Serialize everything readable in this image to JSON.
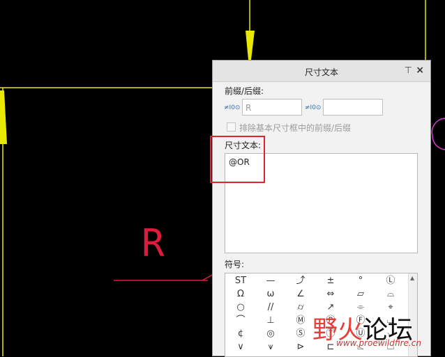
{
  "dialog": {
    "title": "尺寸文本",
    "pin_icon": "pin-icon",
    "close_icon": "×",
    "prefix_suffix_label": "前缀/后缀:",
    "prefix_fx": "≠I0⊙",
    "prefix_value": "R",
    "suffix_fx": "≠I0⊙",
    "suffix_value": "",
    "exclude_label": "排除基本尺寸框中的前缀/后缀",
    "dim_text_label": "尺寸文本:",
    "dim_text_value": "@OR",
    "symbols_label": "符号:"
  },
  "symbols": [
    "ST",
    "—",
    "⤴",
    "±",
    "°",
    "Ⓛ",
    "Ω",
    "ω",
    "∠",
    "⇔",
    "▱",
    "⌓",
    "○",
    "//",
    "⌭",
    "↗",
    "⌯",
    "⌖",
    "⌒",
    "⊥",
    "Ⓜ",
    "Ⓟ",
    "Ⓕ",
    "⌴",
    "¢",
    "◎",
    "Ⓢ",
    "Ⓣ",
    "Ⓤ",
    "⌵",
    "∨",
    "⩛",
    "⊳",
    "⊏",
    "⌳",
    "⌴"
  ],
  "canvas": {
    "dim_label": "R",
    "colors": {
      "yellow": "#e8e800",
      "red": "#e01a3c",
      "magenta": "#d23cd2"
    }
  },
  "watermark": {
    "word1": "野火",
    "word2": "论坛",
    "url": "www.proewildfire.cn"
  }
}
